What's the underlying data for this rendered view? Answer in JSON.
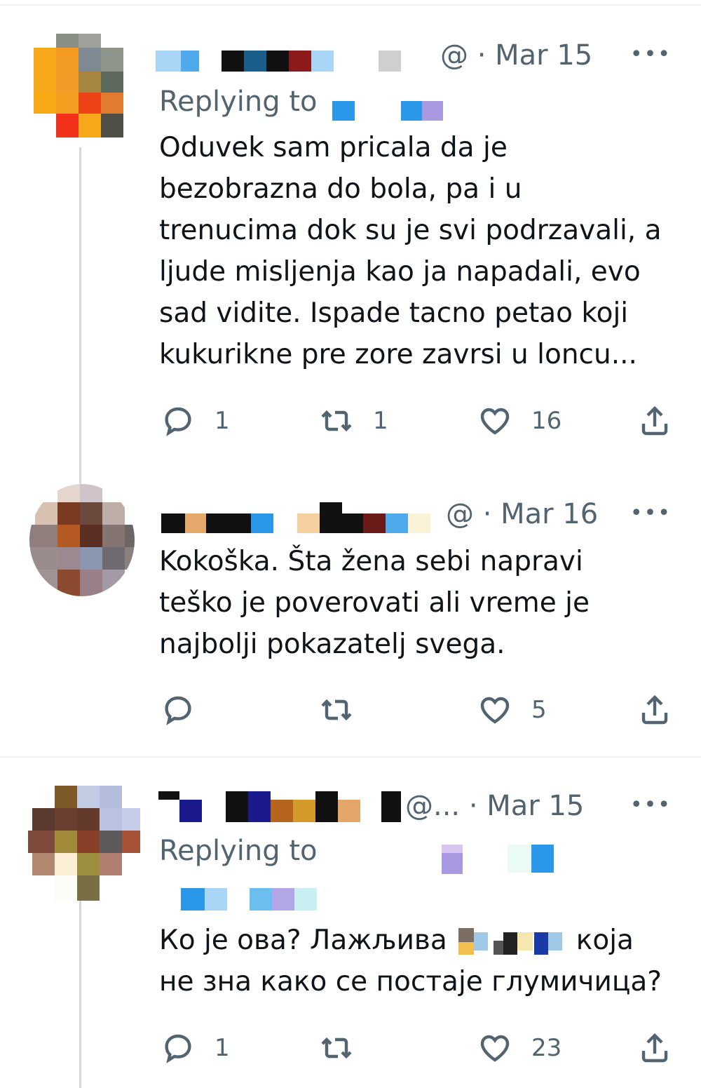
{
  "tweets": [
    {
      "meta": "@ · Mar 15",
      "replying_label": "Replying to",
      "lines": [
        "Oduvek sam pricala da je",
        "bezobrazna do bola, pa i u",
        "trenucima dok su je svi podrzavali, a",
        "ljude misljenja kao ja napadali, evo",
        "sad vidite. Ispade tacno petao koji",
        "kukurikne pre zore zavrsi u loncu..."
      ],
      "replies": "1",
      "retweets": "1",
      "likes": "16"
    },
    {
      "meta": "@ · Mar 16",
      "lines": [
        "Kokoška. Šta žena sebi napravi",
        "teško je poverovati ali vreme je",
        "najbolji pokazatelj svega."
      ],
      "replies": "",
      "retweets": "",
      "likes": "5"
    },
    {
      "meta": "@... · Mar 15",
      "replying_label": "Replying to",
      "line1_a": "Ко је ова? Лажљива",
      "line1_b": "која",
      "line2": "не зна како се постаје глумичица?",
      "replies": "1",
      "retweets": "",
      "likes": "23"
    }
  ],
  "more_label": "•••",
  "icons": [
    "reply-icon",
    "retweet-icon",
    "like-icon",
    "share-icon",
    "more-icon"
  ],
  "colors": {
    "text": "#0f1419",
    "secondary": "#536471",
    "thread_line": "#cfd9de"
  }
}
